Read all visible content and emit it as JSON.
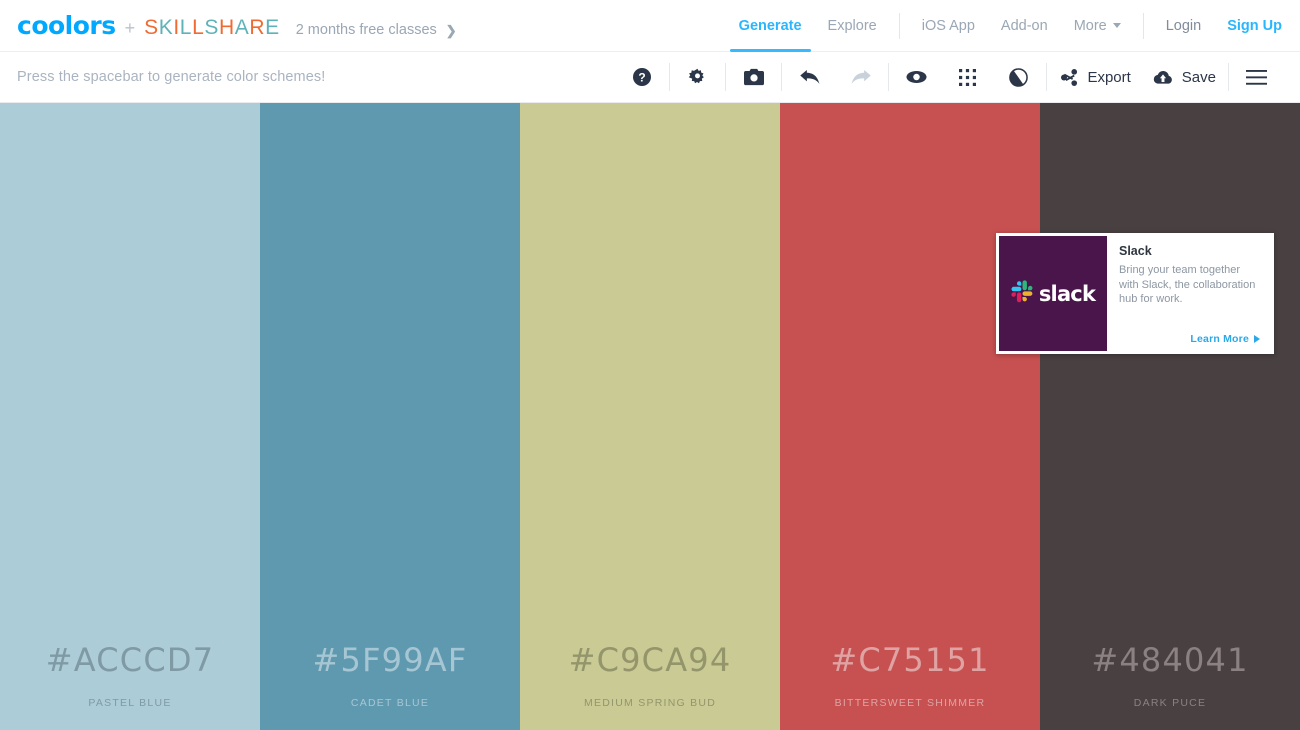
{
  "topnav": {
    "brand": "coolors",
    "plus": "+",
    "partner": "SKILLSHARE",
    "promo_label": "2 months free classes",
    "promo_chevron": "❯",
    "items": [
      {
        "label": "Generate",
        "name": "nav-generate",
        "active": true
      },
      {
        "label": "Explore",
        "name": "nav-explore",
        "active": false
      },
      {
        "label": "iOS App",
        "name": "nav-ios-app",
        "active": false
      },
      {
        "label": "Add-on",
        "name": "nav-add-on",
        "active": false
      },
      {
        "label": "More",
        "name": "nav-more",
        "active": false
      },
      {
        "label": "Login",
        "name": "nav-login",
        "active": false
      },
      {
        "label": "Sign Up",
        "name": "nav-sign-up",
        "active": false
      }
    ],
    "accent_color": "#29b6ff",
    "underline_color": "#35baff",
    "brand_color": "#00a8ff",
    "partner_orange": "#f06a32",
    "partner_teal": "#5fb3b8"
  },
  "toolbar": {
    "hint": "Press the spacebar to generate color schemes!",
    "icons": [
      {
        "name": "help-icon",
        "title": "Help"
      },
      {
        "name": "gear-icon",
        "title": "Settings"
      },
      {
        "name": "camera-icon",
        "title": "Take a picture"
      },
      {
        "name": "undo-icon",
        "title": "Undo",
        "disabled": false
      },
      {
        "name": "redo-icon",
        "title": "Redo",
        "disabled": true
      },
      {
        "name": "eye-icon",
        "title": "View colorblind"
      },
      {
        "name": "grid-icon",
        "title": "Adjust palette"
      },
      {
        "name": "contrast-icon",
        "title": "Contrast checker"
      }
    ],
    "export_label": "Export",
    "save_label": "Save",
    "menu_label": "Menu"
  },
  "palette": [
    {
      "hex": "#ACCCD7",
      "name": "PASTEL BLUE",
      "text_color": "#7f9aa4"
    },
    {
      "hex": "#5F99AF",
      "name": "CADET BLUE",
      "text_color": "#a7c6d3"
    },
    {
      "hex": "#C9CA94",
      "name": "MEDIUM SPRING BUD",
      "text_color": "#94956b"
    },
    {
      "hex": "#C75151",
      "name": "BITTERSWEET SHIMMER",
      "text_color": "#dfa3a3"
    },
    {
      "hex": "#484041",
      "name": "DARK PUCE",
      "text_color": "#8b8183"
    }
  ],
  "ad": {
    "brand": "slack",
    "title": "Slack",
    "description": "Bring your team together with Slack, the collaboration hub for work.",
    "cta": "Learn More",
    "logo_bg": "#4a154b",
    "cta_color": "#2ca8e8"
  }
}
